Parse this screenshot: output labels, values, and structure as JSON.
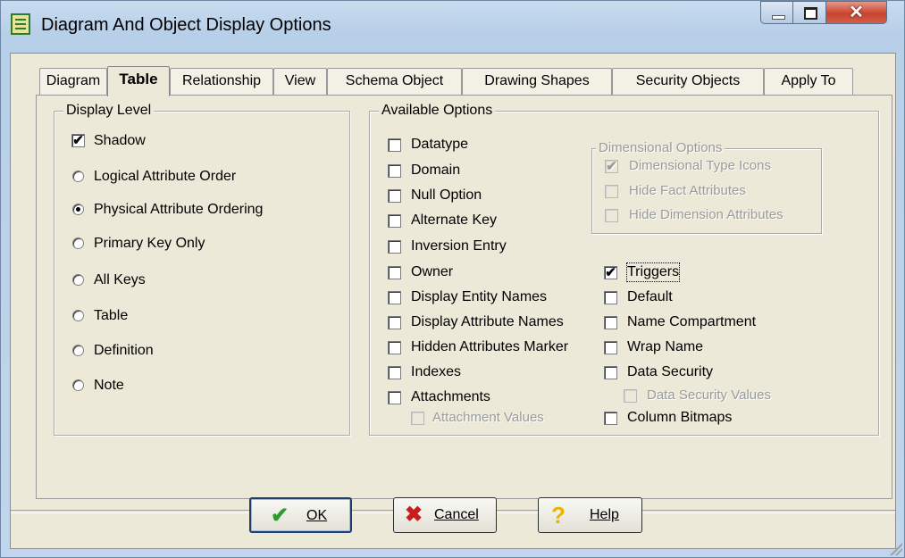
{
  "window": {
    "title": "Diagram And Object Display Options",
    "close_glyph": "✕"
  },
  "tabs": [
    {
      "label": "Diagram"
    },
    {
      "label": "Table",
      "active": true
    },
    {
      "label": "Relationship"
    },
    {
      "label": "View"
    },
    {
      "label": "Schema Object"
    },
    {
      "label": "Drawing Shapes"
    },
    {
      "label": "Security Objects"
    },
    {
      "label": "Apply To"
    }
  ],
  "display_level": {
    "title": "Display Level",
    "shadow": {
      "label": "Shadow",
      "checked": true
    },
    "radios": [
      {
        "label": "Logical Attribute Order",
        "selected": false
      },
      {
        "label": "Physical Attribute Ordering",
        "selected": true
      },
      {
        "label": "Primary Key Only",
        "selected": false
      },
      {
        "label": "All Keys",
        "selected": false
      },
      {
        "label": "Table",
        "selected": false
      },
      {
        "label": "Definition",
        "selected": false
      },
      {
        "label": "Note",
        "selected": false
      }
    ]
  },
  "available_options": {
    "title": "Available Options",
    "left": [
      {
        "label": "Datatype",
        "checked": false
      },
      {
        "label": "Domain",
        "checked": false
      },
      {
        "label": "Null Option",
        "checked": false
      },
      {
        "label": "Alternate Key",
        "checked": false
      },
      {
        "label": "Inversion Entry",
        "checked": false
      },
      {
        "label": "Owner",
        "checked": false
      },
      {
        "label": "Display Entity Names",
        "checked": false
      },
      {
        "label": "Display Attribute Names",
        "checked": false
      },
      {
        "label": "Hidden Attributes Marker",
        "checked": false
      },
      {
        "label": "Indexes",
        "checked": false
      },
      {
        "label": "Attachments",
        "checked": false
      },
      {
        "label": "Attachment Values",
        "checked": false,
        "disabled": true
      }
    ],
    "right": [
      {
        "label": "Triggers",
        "checked": true
      },
      {
        "label": "Default",
        "checked": false
      },
      {
        "label": "Name Compartment",
        "checked": false
      },
      {
        "label": "Wrap Name",
        "checked": false
      },
      {
        "label": "Data Security",
        "checked": false
      },
      {
        "label": "Data Security Values",
        "checked": false,
        "disabled": true
      },
      {
        "label": "Column Bitmaps",
        "checked": false
      }
    ],
    "dimensional": {
      "title": "Dimensional Options",
      "items": [
        {
          "label": "Dimensional Type Icons",
          "checked": true,
          "disabled": true
        },
        {
          "label": "Hide Fact Attributes",
          "checked": false,
          "disabled": true
        },
        {
          "label": "Hide Dimension Attributes",
          "checked": false,
          "disabled": true
        }
      ]
    }
  },
  "buttons": {
    "ok": {
      "label": "OK",
      "icon": "check-icon",
      "icon_color": "#2e9a2e"
    },
    "cancel": {
      "label": "Cancel",
      "icon": "x-icon",
      "icon_color": "#c81e1e"
    },
    "help": {
      "label": "Help",
      "icon": "question-icon",
      "icon_color": "#e8b400"
    }
  },
  "check_glyph": "✔"
}
